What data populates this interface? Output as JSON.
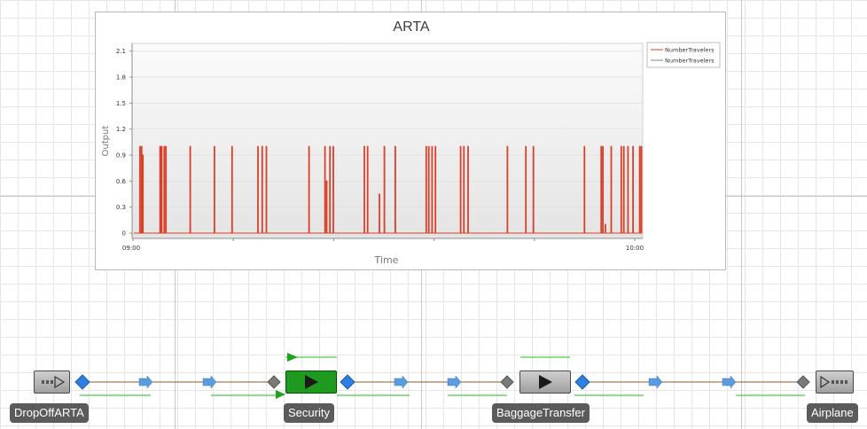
{
  "chart_data": {
    "type": "line",
    "title": "ARTA",
    "xlabel": "Time",
    "ylabel": "Output",
    "x_tick_labels": [
      "09:00",
      "10:00"
    ],
    "y_ticks": [
      0,
      0.3,
      0.6,
      0.9,
      1.2,
      1.5,
      1.8,
      2.1
    ],
    "ylim": [
      0,
      2.25
    ],
    "xlim_minutes": [
      0,
      61
    ],
    "legend_position": "top-right",
    "legend": [
      "NumberTravelers",
      "NumberTravelers"
    ],
    "series": [
      {
        "name": "NumberTravelers",
        "color": "#d9402a",
        "baseline": 0,
        "spikes": [
          {
            "t": 0.9,
            "v": 1.0
          },
          {
            "t": 1.1,
            "v": 1.0
          },
          {
            "t": 1.25,
            "v": 0.9
          },
          {
            "t": 3.3,
            "v": 1.0
          },
          {
            "t": 3.5,
            "v": 1.0
          },
          {
            "t": 3.8,
            "v": 1.0
          },
          {
            "t": 4.0,
            "v": 1.0
          },
          {
            "t": 6.9,
            "v": 1.0
          },
          {
            "t": 9.8,
            "v": 1.0
          },
          {
            "t": 11.9,
            "v": 1.0
          },
          {
            "t": 15.0,
            "v": 1.0
          },
          {
            "t": 15.5,
            "v": 1.0
          },
          {
            "t": 16.0,
            "v": 1.0
          },
          {
            "t": 21.1,
            "v": 1.0
          },
          {
            "t": 23.0,
            "v": 1.0
          },
          {
            "t": 23.2,
            "v": 0.6
          },
          {
            "t": 23.6,
            "v": 1.0
          },
          {
            "t": 24.0,
            "v": 1.0
          },
          {
            "t": 27.7,
            "v": 1.0
          },
          {
            "t": 28.1,
            "v": 1.0
          },
          {
            "t": 29.5,
            "v": 0.45
          },
          {
            "t": 30.1,
            "v": 1.0
          },
          {
            "t": 31.4,
            "v": 1.0
          },
          {
            "t": 35.1,
            "v": 1.0
          },
          {
            "t": 35.4,
            "v": 1.0
          },
          {
            "t": 35.8,
            "v": 1.0
          },
          {
            "t": 36.2,
            "v": 1.0
          },
          {
            "t": 39.2,
            "v": 1.0
          },
          {
            "t": 39.6,
            "v": 1.0
          },
          {
            "t": 40.1,
            "v": 1.0
          },
          {
            "t": 44.8,
            "v": 1.0
          },
          {
            "t": 47.0,
            "v": 1.0
          },
          {
            "t": 47.9,
            "v": 1.0
          },
          {
            "t": 54.0,
            "v": 1.0
          },
          {
            "t": 56.0,
            "v": 1.0
          },
          {
            "t": 56.2,
            "v": 1.0
          },
          {
            "t": 56.5,
            "v": 0.1
          },
          {
            "t": 57.2,
            "v": 1.0
          },
          {
            "t": 58.4,
            "v": 1.0
          },
          {
            "t": 58.7,
            "v": 1.0
          },
          {
            "t": 59.2,
            "v": 1.0
          },
          {
            "t": 59.8,
            "v": 1.0
          },
          {
            "t": 60.6,
            "v": 1.0
          },
          {
            "t": 60.8,
            "v": 1.0
          }
        ]
      },
      {
        "name": "NumberTravelers",
        "color": "#6f8f83",
        "baseline": 0,
        "spikes": []
      }
    ]
  },
  "flow": {
    "blocks": [
      {
        "label": "DropOffARTA",
        "icon": "drop-off-icon"
      },
      {
        "label": "Security",
        "icon": "play-icon",
        "active": true,
        "color": "#1e9a1e"
      },
      {
        "label": "BaggageTransfer",
        "icon": "play-icon"
      },
      {
        "label": "Airplane",
        "icon": "airplane-sink-icon"
      }
    ],
    "colors": {
      "connector": "#8a5a2b",
      "arrow": "#4f8fd6",
      "port_in": "#2f7fe0",
      "port_out": "#6e6e6e",
      "stat_line": "#1fbf1f"
    }
  }
}
